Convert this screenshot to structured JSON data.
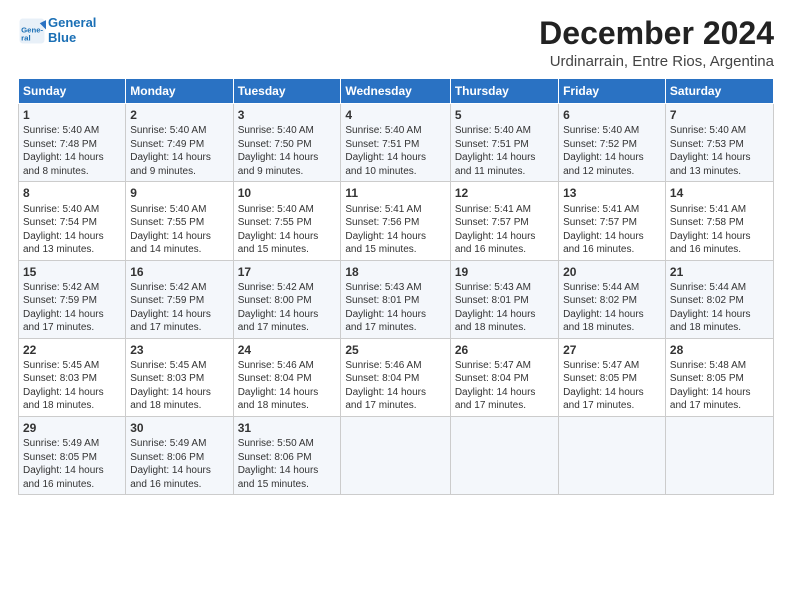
{
  "logo": {
    "line1": "General",
    "line2": "Blue"
  },
  "title": "December 2024",
  "subtitle": "Urdinarrain, Entre Rios, Argentina",
  "weekdays": [
    "Sunday",
    "Monday",
    "Tuesday",
    "Wednesday",
    "Thursday",
    "Friday",
    "Saturday"
  ],
  "weeks": [
    [
      {
        "day": 1,
        "lines": [
          "Sunrise: 5:40 AM",
          "Sunset: 7:48 PM",
          "Daylight: 14 hours",
          "and 8 minutes."
        ]
      },
      {
        "day": 2,
        "lines": [
          "Sunrise: 5:40 AM",
          "Sunset: 7:49 PM",
          "Daylight: 14 hours",
          "and 9 minutes."
        ]
      },
      {
        "day": 3,
        "lines": [
          "Sunrise: 5:40 AM",
          "Sunset: 7:50 PM",
          "Daylight: 14 hours",
          "and 9 minutes."
        ]
      },
      {
        "day": 4,
        "lines": [
          "Sunrise: 5:40 AM",
          "Sunset: 7:51 PM",
          "Daylight: 14 hours",
          "and 10 minutes."
        ]
      },
      {
        "day": 5,
        "lines": [
          "Sunrise: 5:40 AM",
          "Sunset: 7:51 PM",
          "Daylight: 14 hours",
          "and 11 minutes."
        ]
      },
      {
        "day": 6,
        "lines": [
          "Sunrise: 5:40 AM",
          "Sunset: 7:52 PM",
          "Daylight: 14 hours",
          "and 12 minutes."
        ]
      },
      {
        "day": 7,
        "lines": [
          "Sunrise: 5:40 AM",
          "Sunset: 7:53 PM",
          "Daylight: 14 hours",
          "and 13 minutes."
        ]
      }
    ],
    [
      {
        "day": 8,
        "lines": [
          "Sunrise: 5:40 AM",
          "Sunset: 7:54 PM",
          "Daylight: 14 hours",
          "and 13 minutes."
        ]
      },
      {
        "day": 9,
        "lines": [
          "Sunrise: 5:40 AM",
          "Sunset: 7:55 PM",
          "Daylight: 14 hours",
          "and 14 minutes."
        ]
      },
      {
        "day": 10,
        "lines": [
          "Sunrise: 5:40 AM",
          "Sunset: 7:55 PM",
          "Daylight: 14 hours",
          "and 15 minutes."
        ]
      },
      {
        "day": 11,
        "lines": [
          "Sunrise: 5:41 AM",
          "Sunset: 7:56 PM",
          "Daylight: 14 hours",
          "and 15 minutes."
        ]
      },
      {
        "day": 12,
        "lines": [
          "Sunrise: 5:41 AM",
          "Sunset: 7:57 PM",
          "Daylight: 14 hours",
          "and 16 minutes."
        ]
      },
      {
        "day": 13,
        "lines": [
          "Sunrise: 5:41 AM",
          "Sunset: 7:57 PM",
          "Daylight: 14 hours",
          "and 16 minutes."
        ]
      },
      {
        "day": 14,
        "lines": [
          "Sunrise: 5:41 AM",
          "Sunset: 7:58 PM",
          "Daylight: 14 hours",
          "and 16 minutes."
        ]
      }
    ],
    [
      {
        "day": 15,
        "lines": [
          "Sunrise: 5:42 AM",
          "Sunset: 7:59 PM",
          "Daylight: 14 hours",
          "and 17 minutes."
        ]
      },
      {
        "day": 16,
        "lines": [
          "Sunrise: 5:42 AM",
          "Sunset: 7:59 PM",
          "Daylight: 14 hours",
          "and 17 minutes."
        ]
      },
      {
        "day": 17,
        "lines": [
          "Sunrise: 5:42 AM",
          "Sunset: 8:00 PM",
          "Daylight: 14 hours",
          "and 17 minutes."
        ]
      },
      {
        "day": 18,
        "lines": [
          "Sunrise: 5:43 AM",
          "Sunset: 8:01 PM",
          "Daylight: 14 hours",
          "and 17 minutes."
        ]
      },
      {
        "day": 19,
        "lines": [
          "Sunrise: 5:43 AM",
          "Sunset: 8:01 PM",
          "Daylight: 14 hours",
          "and 18 minutes."
        ]
      },
      {
        "day": 20,
        "lines": [
          "Sunrise: 5:44 AM",
          "Sunset: 8:02 PM",
          "Daylight: 14 hours",
          "and 18 minutes."
        ]
      },
      {
        "day": 21,
        "lines": [
          "Sunrise: 5:44 AM",
          "Sunset: 8:02 PM",
          "Daylight: 14 hours",
          "and 18 minutes."
        ]
      }
    ],
    [
      {
        "day": 22,
        "lines": [
          "Sunrise: 5:45 AM",
          "Sunset: 8:03 PM",
          "Daylight: 14 hours",
          "and 18 minutes."
        ]
      },
      {
        "day": 23,
        "lines": [
          "Sunrise: 5:45 AM",
          "Sunset: 8:03 PM",
          "Daylight: 14 hours",
          "and 18 minutes."
        ]
      },
      {
        "day": 24,
        "lines": [
          "Sunrise: 5:46 AM",
          "Sunset: 8:04 PM",
          "Daylight: 14 hours",
          "and 18 minutes."
        ]
      },
      {
        "day": 25,
        "lines": [
          "Sunrise: 5:46 AM",
          "Sunset: 8:04 PM",
          "Daylight: 14 hours",
          "and 17 minutes."
        ]
      },
      {
        "day": 26,
        "lines": [
          "Sunrise: 5:47 AM",
          "Sunset: 8:04 PM",
          "Daylight: 14 hours",
          "and 17 minutes."
        ]
      },
      {
        "day": 27,
        "lines": [
          "Sunrise: 5:47 AM",
          "Sunset: 8:05 PM",
          "Daylight: 14 hours",
          "and 17 minutes."
        ]
      },
      {
        "day": 28,
        "lines": [
          "Sunrise: 5:48 AM",
          "Sunset: 8:05 PM",
          "Daylight: 14 hours",
          "and 17 minutes."
        ]
      }
    ],
    [
      {
        "day": 29,
        "lines": [
          "Sunrise: 5:49 AM",
          "Sunset: 8:05 PM",
          "Daylight: 14 hours",
          "and 16 minutes."
        ]
      },
      {
        "day": 30,
        "lines": [
          "Sunrise: 5:49 AM",
          "Sunset: 8:06 PM",
          "Daylight: 14 hours",
          "and 16 minutes."
        ]
      },
      {
        "day": 31,
        "lines": [
          "Sunrise: 5:50 AM",
          "Sunset: 8:06 PM",
          "Daylight: 14 hours",
          "and 15 minutes."
        ]
      },
      null,
      null,
      null,
      null
    ]
  ]
}
